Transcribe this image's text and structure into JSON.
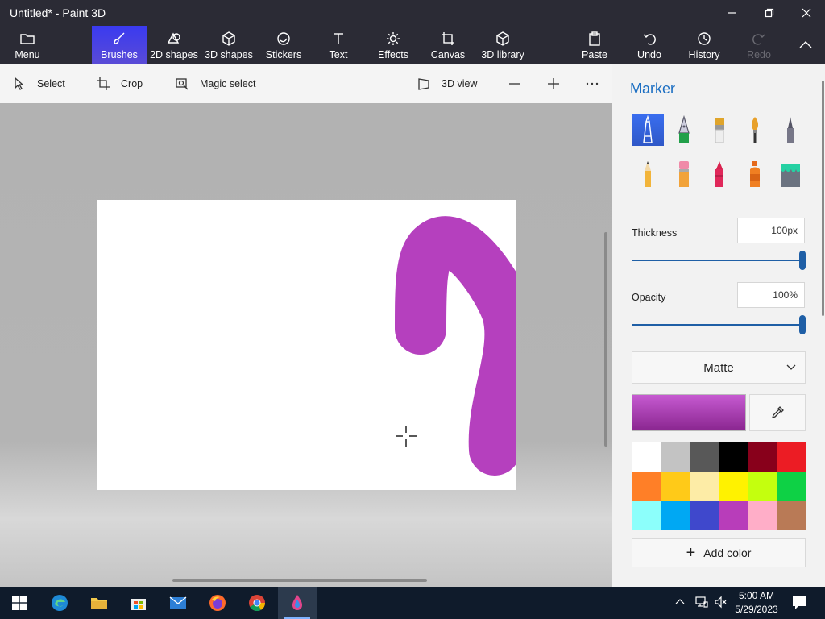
{
  "window": {
    "title": "Untitled* - Paint 3D"
  },
  "ribbon": {
    "menu": "Menu",
    "tools": [
      "Brushes",
      "2D shapes",
      "3D shapes",
      "Stickers",
      "Text",
      "Effects",
      "Canvas",
      "3D library"
    ],
    "active_tool": "Brushes",
    "actions": [
      "Paste",
      "Undo",
      "History",
      "Redo"
    ]
  },
  "toolbar": {
    "select": "Select",
    "crop": "Crop",
    "magic_select": "Magic select",
    "view_3d": "3D view"
  },
  "panel": {
    "title": "Marker",
    "brushes": [
      "marker",
      "calligraphy-pen",
      "oil-brush",
      "watercolor",
      "pixel-pen",
      "pencil",
      "eraser",
      "crayon",
      "spray-can",
      "fill"
    ],
    "thickness_label": "Thickness",
    "thickness_value": "100px",
    "thickness_level": 1.0,
    "opacity_label": "Opacity",
    "opacity_value": "100%",
    "opacity_level": 1.0,
    "finish": "Matte",
    "current_color": "#b540be",
    "palette": [
      "#ffffff",
      "#c3c3c3",
      "#585858",
      "#000000",
      "#88001b",
      "#ec1c24",
      "#ff7f27",
      "#ffca18",
      "#fdeca6",
      "#fff200",
      "#c4ff0e",
      "#0ed145",
      "#8cfffb",
      "#00a8f3",
      "#3f48cc",
      "#b83dba",
      "#ffaec8",
      "#b97a56"
    ],
    "add_color": "Add color"
  },
  "taskbar": {
    "time": "5:00 AM",
    "date": "5/29/2023"
  }
}
